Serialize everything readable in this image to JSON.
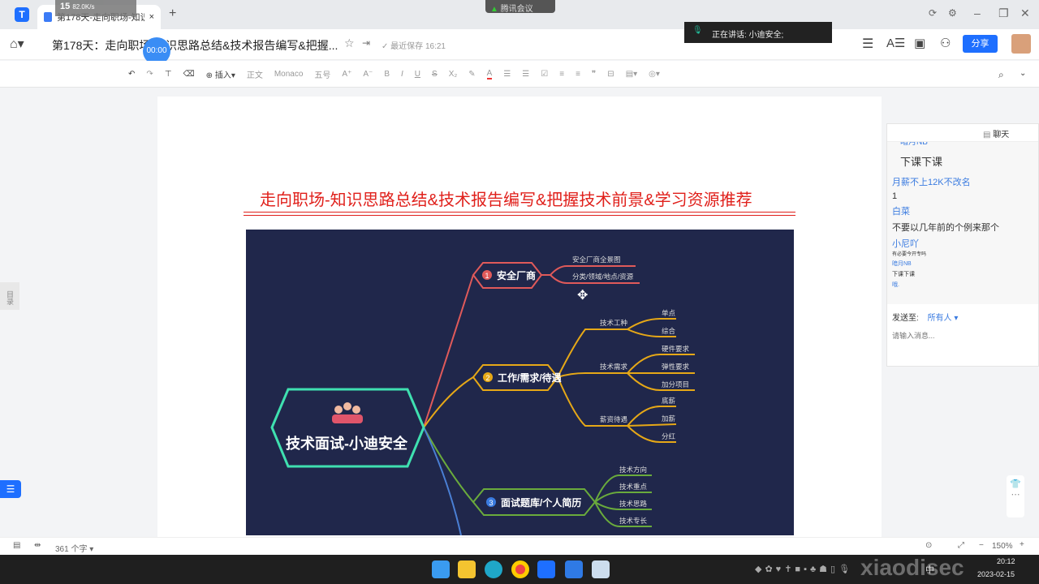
{
  "browser": {
    "tab_title": "第178天-走向职场-知识...",
    "new_tab": "+",
    "close": "×"
  },
  "overlay": {
    "battery": "15",
    "net": "82.0K/s",
    "meeting": "腾讯会议",
    "timer": "00:00",
    "speaking": "正在讲话: 小迪安全;"
  },
  "header": {
    "doc_title": "第178天：走向职场-知识思路总结&技术报告编写&把握...",
    "save_status": "最近保存 16:21",
    "share": "分享"
  },
  "toolbar": {
    "insert": "插入",
    "style": "正文",
    "font": "Monaco",
    "size": "五号"
  },
  "doc": {
    "title": "走向职场-知识思路总结&技术报告编写&把握技术前景&学习资源推荐",
    "toc": "目录"
  },
  "mindmap": {
    "center": "技术面试-小迪安全",
    "branches": [
      {
        "num": "1",
        "label": "安全厂商",
        "color": "#e05a5a",
        "children": [
          "安全厂商全景图",
          "分类/领域/地点/资源"
        ]
      },
      {
        "num": "2",
        "label": "工作/需求/待遇",
        "color": "#e6a817",
        "children": [
          {
            "label": "技术工种",
            "children": [
              "单点",
              "综合"
            ]
          },
          {
            "label": "技术需求",
            "children": [
              "硬件要求",
              "弹性要求",
              "加分项目"
            ]
          },
          {
            "label": "薪资待遇",
            "children": [
              "底薪",
              "加薪",
              "分红"
            ]
          }
        ]
      },
      {
        "num": "3",
        "label": "面试题库/个人简历",
        "color": "#6aab3c",
        "children": [
          "技术方向",
          "技术重点",
          "技术思路",
          "技术专长"
        ]
      }
    ]
  },
  "chat": {
    "title": "聊天",
    "messages": [
      {
        "name": "暗月NB",
        "text": "下课下课"
      },
      {
        "name": "月薪不上12K不改名",
        "text": "1"
      },
      {
        "name": "白菜",
        "text": "不要以几年前的个例来那个"
      },
      {
        "name": "小尼吖",
        "text": "有必要今开专吗"
      },
      {
        "name": "暗月NB",
        "text": "下课下课"
      },
      {
        "name": "哦.",
        "text": ""
      }
    ],
    "send_to_label": "发送至:",
    "send_to": "所有人",
    "placeholder": "请输入消息..."
  },
  "status": {
    "word_count": "361 个字",
    "zoom": "150%"
  },
  "taskbar": {
    "time": "20:12",
    "date": "2023-02-15",
    "ime": "中",
    "watermark": "xiaodisec"
  }
}
